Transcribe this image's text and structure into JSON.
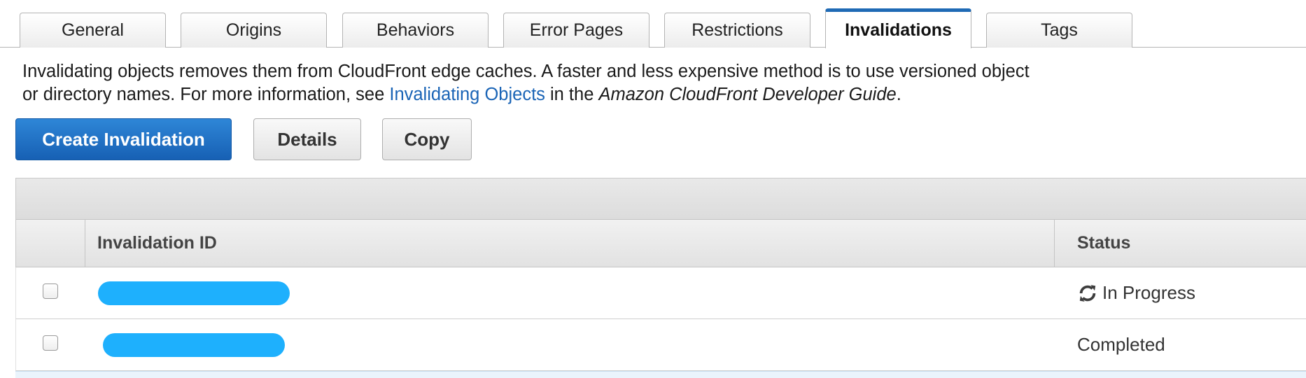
{
  "tabs": [
    {
      "label": "General"
    },
    {
      "label": "Origins"
    },
    {
      "label": "Behaviors"
    },
    {
      "label": "Error Pages"
    },
    {
      "label": "Restrictions"
    },
    {
      "label": "Invalidations",
      "active": true
    },
    {
      "label": "Tags"
    }
  ],
  "description": {
    "line1": "Invalidating objects removes them from CloudFront edge caches. A faster and less expensive method is to use versioned object",
    "line2_prefix": "or directory names. For more information, see ",
    "link_text": "Invalidating Objects",
    "middle": " in the ",
    "guide_title": "Amazon CloudFront Developer Guide",
    "suffix": "."
  },
  "buttons": {
    "create": "Create Invalidation",
    "details": "Details",
    "copy": "Copy"
  },
  "table": {
    "columns": {
      "id": "Invalidation ID",
      "status": "Status"
    },
    "rows": [
      {
        "status": "In Progress",
        "status_icon": "refresh-icon"
      },
      {
        "status": "Completed"
      }
    ]
  },
  "colors": {
    "accent": "#1f6ab5",
    "link": "#1a64b6",
    "redaction": "#1eb0fd"
  }
}
